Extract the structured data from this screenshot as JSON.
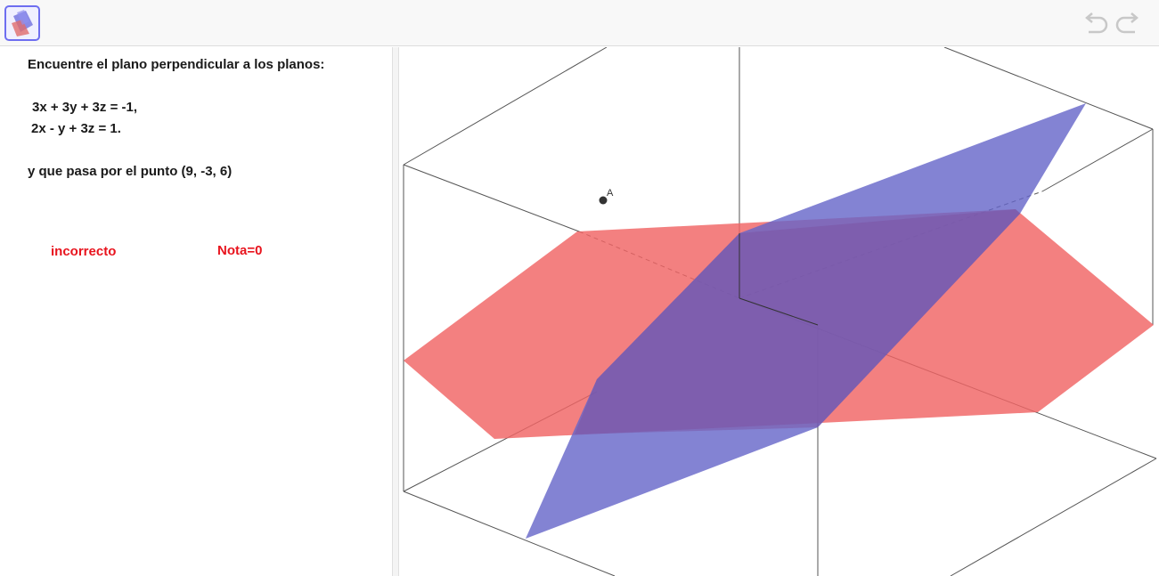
{
  "toolbar": {
    "app_icon": "3d-plane-app-icon",
    "undo_icon": "undo-icon",
    "redo_icon": "redo-icon"
  },
  "problem": {
    "statement": "Encuentre el plano perpendicular a los planos:",
    "equation_1": "3x + 3y + 3z = -1,",
    "equation_2": "2x - y + 3z = 1.",
    "point_text": "y que pasa por el punto (9, -3, 6)"
  },
  "result": {
    "status": "incorrecto",
    "grade": "Nota=0",
    "color": "#e8141e"
  },
  "graphics": {
    "point_label": "A",
    "plane_1_color": "#f06464",
    "plane_2_color": "#6464c8"
  }
}
